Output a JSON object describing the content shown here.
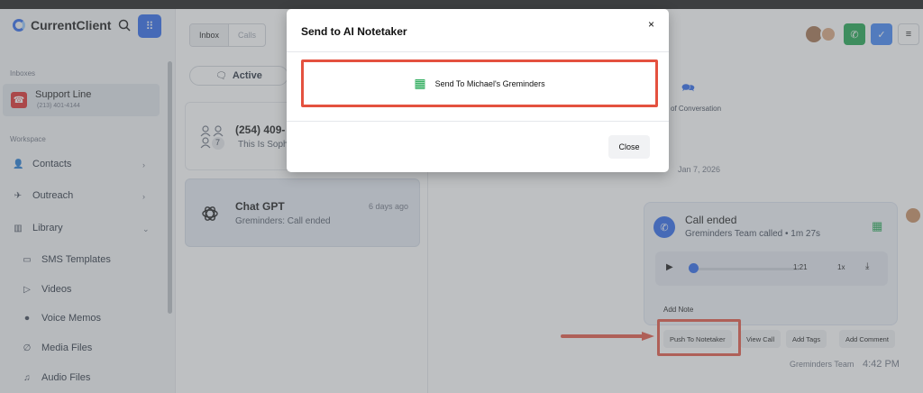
{
  "app": {
    "name": "CurrentClient"
  },
  "sidebar": {
    "inboxes_label": "Inboxes",
    "line": {
      "name": "Support Line",
      "phone": "(213) 401-4144"
    },
    "workspace_label": "Workspace",
    "items": [
      {
        "label": "Contacts",
        "icon": "person-icon"
      },
      {
        "label": "Outreach",
        "icon": "megaphone-icon"
      },
      {
        "label": "Library",
        "icon": "book-icon"
      },
      {
        "label": "SMS Templates",
        "icon": "message-icon"
      },
      {
        "label": "Videos",
        "icon": "video-icon"
      },
      {
        "label": "Voice Memos",
        "icon": "mic-icon"
      },
      {
        "label": "Media Files",
        "icon": "paperclip-icon"
      },
      {
        "label": "Audio Files",
        "icon": "music-icon"
      }
    ]
  },
  "tabs": {
    "inbox": "Inbox",
    "calls": "Calls"
  },
  "filter": {
    "active": "Active"
  },
  "conversations": [
    {
      "name": "(254) 409-",
      "preview": "This Is Soph",
      "badge": "7",
      "time": ""
    },
    {
      "name": "Chat GPT",
      "preview": "Greminders: Call ended",
      "time": "6 days ago"
    }
  ],
  "thread": {
    "header_label": "of Conversation",
    "date": "Jan 7, 2026",
    "message": {
      "title": "Call ended",
      "meta": "Greminders Team called • 1m 27s",
      "duration": "1:21",
      "speed": "1x",
      "progress": 0,
      "add_note": "Add Note"
    },
    "actions": {
      "push": "Push To Notetaker",
      "view": "View Call",
      "tags": "Add Tags",
      "comment": "Add Comment"
    },
    "sender": "Greminders Team",
    "sent_time": "4:42 PM"
  },
  "modal": {
    "title": "Send to AI Notetaker",
    "close_icon": "×",
    "send_label": "Send To Michael's Greminders",
    "close_label": "Close"
  },
  "colors": {
    "accent": "#2563eb",
    "highlight": "#e4513f",
    "call_green": "#16a34a"
  }
}
